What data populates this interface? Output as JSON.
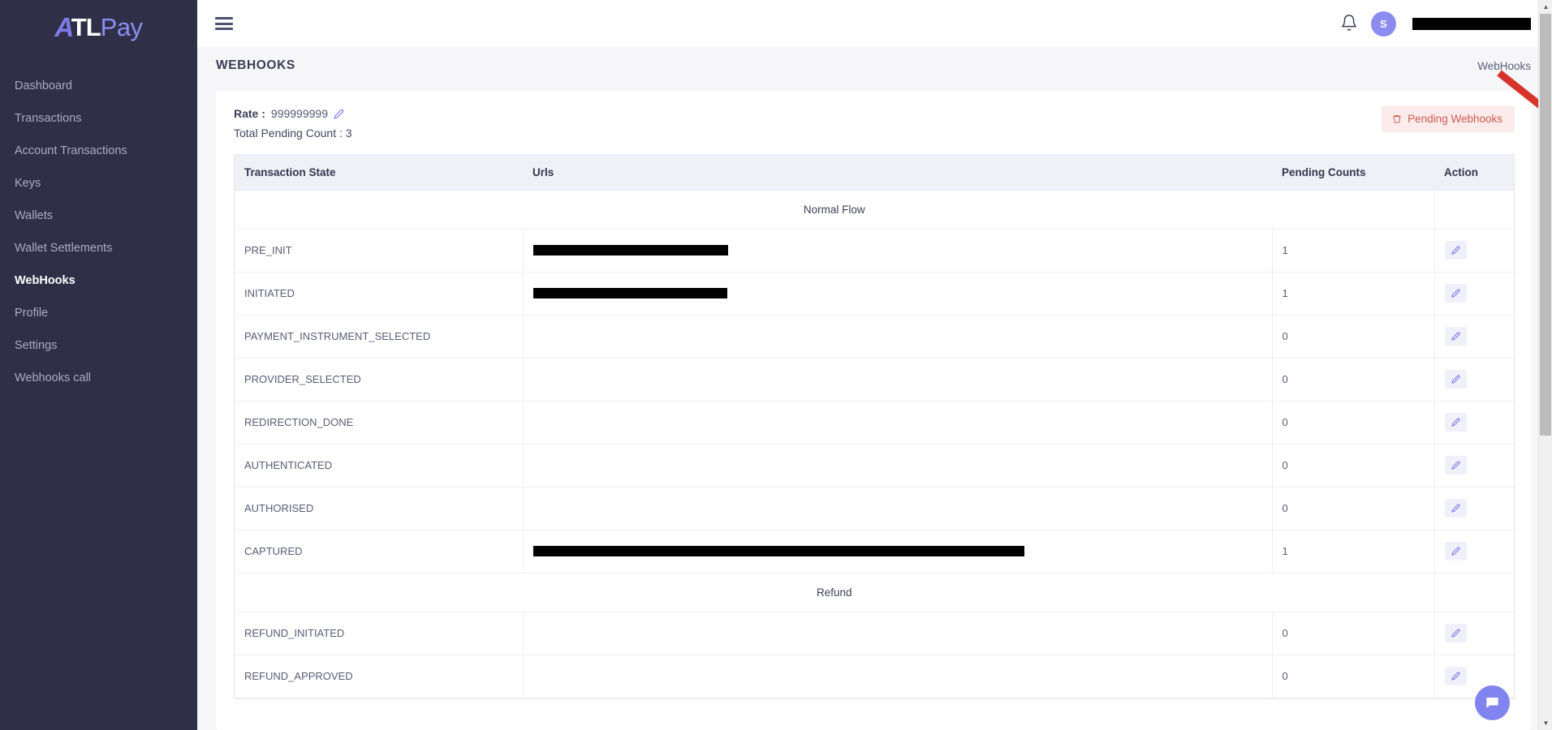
{
  "brand": {
    "logo_mark": "A",
    "logo_primary": "TL",
    "logo_secondary": "Pay",
    "accent": "#8a8cf0",
    "sidebar_bg": "#2f3047"
  },
  "sidebar": {
    "items": [
      {
        "label": "Dashboard",
        "active": false
      },
      {
        "label": "Transactions",
        "active": false
      },
      {
        "label": "Account Transactions",
        "active": false
      },
      {
        "label": "Keys",
        "active": false
      },
      {
        "label": "Wallets",
        "active": false
      },
      {
        "label": "Wallet Settlements",
        "active": false
      },
      {
        "label": "WebHooks",
        "active": true
      },
      {
        "label": "Profile",
        "active": false
      },
      {
        "label": "Settings",
        "active": false
      },
      {
        "label": "Webhooks call",
        "active": false
      }
    ]
  },
  "topbar": {
    "menu_icon": "hamburger-icon",
    "notification_icon": "bell-icon",
    "avatar_initial": "S",
    "username": ""
  },
  "page": {
    "title": "WEBHOOKS",
    "breadcrumb": "WebHooks"
  },
  "meta": {
    "rate_label": "Rate :",
    "rate_value": "999999999",
    "edit_icon": "pencil-icon",
    "pending_count_label": "Total Pending Count : 3"
  },
  "actions": {
    "pending_webhooks_label": "Pending Webhooks",
    "pending_webhooks_icon": "trash-icon",
    "pending_webhooks_bg": "#fbeceb",
    "pending_webhooks_color": "#cc5b52"
  },
  "annotation": {
    "arrow_color": "#d6342a",
    "points_to": "Pending Webhooks"
  },
  "table": {
    "columns": [
      "Transaction State",
      "Urls",
      "Pending Counts",
      "Action"
    ],
    "rows": [
      {
        "type": "section",
        "label": "Normal Flow"
      },
      {
        "type": "data",
        "state": "PRE_INIT",
        "url_redacted": true,
        "url_width": 240,
        "count": "1",
        "action_icon": "pencil-icon"
      },
      {
        "type": "data",
        "state": "INITIATED",
        "url_redacted": true,
        "url_width": 239,
        "count": "1",
        "action_icon": "pencil-icon"
      },
      {
        "type": "data",
        "state": "PAYMENT_INSTRUMENT_SELECTED",
        "url_redacted": false,
        "url_width": 0,
        "count": "0",
        "action_icon": "pencil-icon"
      },
      {
        "type": "data",
        "state": "PROVIDER_SELECTED",
        "url_redacted": false,
        "url_width": 0,
        "count": "0",
        "action_icon": "pencil-icon"
      },
      {
        "type": "data",
        "state": "REDIRECTION_DONE",
        "url_redacted": false,
        "url_width": 0,
        "count": "0",
        "action_icon": "pencil-icon"
      },
      {
        "type": "data",
        "state": "AUTHENTICATED",
        "url_redacted": false,
        "url_width": 0,
        "count": "0",
        "action_icon": "pencil-icon"
      },
      {
        "type": "data",
        "state": "AUTHORISED",
        "url_redacted": false,
        "url_width": 0,
        "count": "0",
        "action_icon": "pencil-icon"
      },
      {
        "type": "data",
        "state": "CAPTURED",
        "url_redacted": true,
        "url_width": 605,
        "count": "1",
        "action_icon": "pencil-icon"
      },
      {
        "type": "section",
        "label": "Refund"
      },
      {
        "type": "data",
        "state": "REFUND_INITIATED",
        "url_redacted": false,
        "url_width": 0,
        "count": "0",
        "action_icon": "pencil-icon"
      },
      {
        "type": "data",
        "state": "REFUND_APPROVED",
        "url_redacted": false,
        "url_width": 0,
        "count": "0",
        "action_icon": "pencil-icon"
      }
    ]
  },
  "chat": {
    "icon": "chat-bubble-icon",
    "color": "#8084ef"
  }
}
